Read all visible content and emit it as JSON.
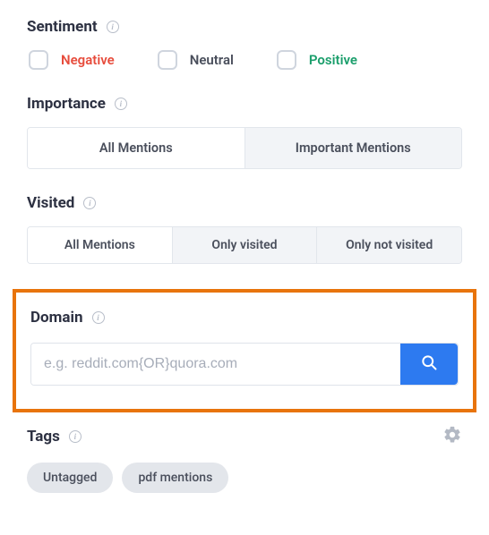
{
  "sentiment": {
    "title": "Sentiment",
    "options": {
      "negative": "Negative",
      "neutral": "Neutral",
      "positive": "Positive"
    }
  },
  "importance": {
    "title": "Importance",
    "tabs": {
      "all": "All Mentions",
      "important": "Important Mentions"
    }
  },
  "visited": {
    "title": "Visited",
    "tabs": {
      "all": "All Mentions",
      "only_visited": "Only visited",
      "only_not_visited": "Only not visited"
    }
  },
  "domain": {
    "title": "Domain",
    "placeholder": "e.g. reddit.com{OR}quora.com"
  },
  "tags": {
    "title": "Tags",
    "chips": {
      "untagged": "Untagged",
      "pdf": "pdf mentions"
    }
  }
}
